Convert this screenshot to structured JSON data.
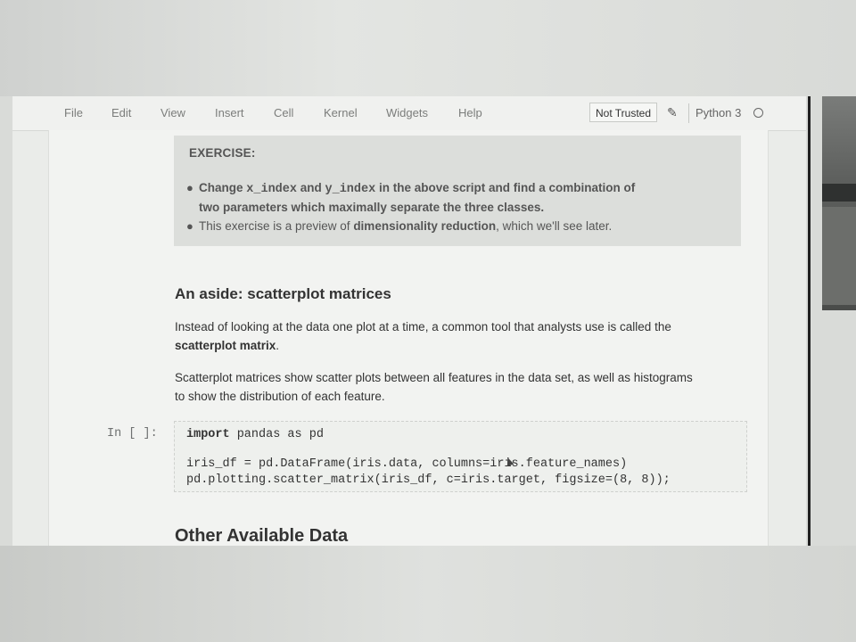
{
  "menubar": {
    "items": [
      "File",
      "Edit",
      "View",
      "Insert",
      "Cell",
      "Kernel",
      "Widgets",
      "Help"
    ],
    "trust_label": "Not Trusted",
    "kernel_name": "Python 3"
  },
  "exercise": {
    "title": "EXERCISE:",
    "bullet1": {
      "pre": "Change ",
      "code1": "x_index",
      "mid": " and ",
      "code2": "y_index",
      "post_line1": " in the above script and find a combination of",
      "line2": "two parameters which maximally separate the three classes."
    },
    "bullet2": {
      "pre": "This exercise is a preview of ",
      "bold": "dimensionality reduction",
      "post": ", which we'll see later."
    }
  },
  "aside": {
    "heading": "An aside: scatterplot matrices",
    "para1_line1": "Instead of looking at the data one plot at a time, a common tool that analysts use is called the",
    "para1_bold": "scatterplot matrix",
    "para1_end": ".",
    "para2_line1": "Scatterplot matrices show scatter plots between all features in the data set, as well as histograms",
    "para2_line2": "to show the distribution of each feature."
  },
  "code_cell": {
    "prompt": "In [ ]:",
    "line1_kw": "import",
    "line1_rest": " pandas as pd",
    "line2": "iris_df = pd.DataFrame(iris.data, columns=iris.feature_names)",
    "line3": "pd.plotting.scatter_matrix(iris_df, c=iris.target, figsize=(8, 8));"
  },
  "next_heading": "Other Available Data",
  "colors": {
    "menu_text": "#7b7d7b",
    "exercise_bg": "#dcdedb",
    "page_bg": "#f2f3f1"
  }
}
